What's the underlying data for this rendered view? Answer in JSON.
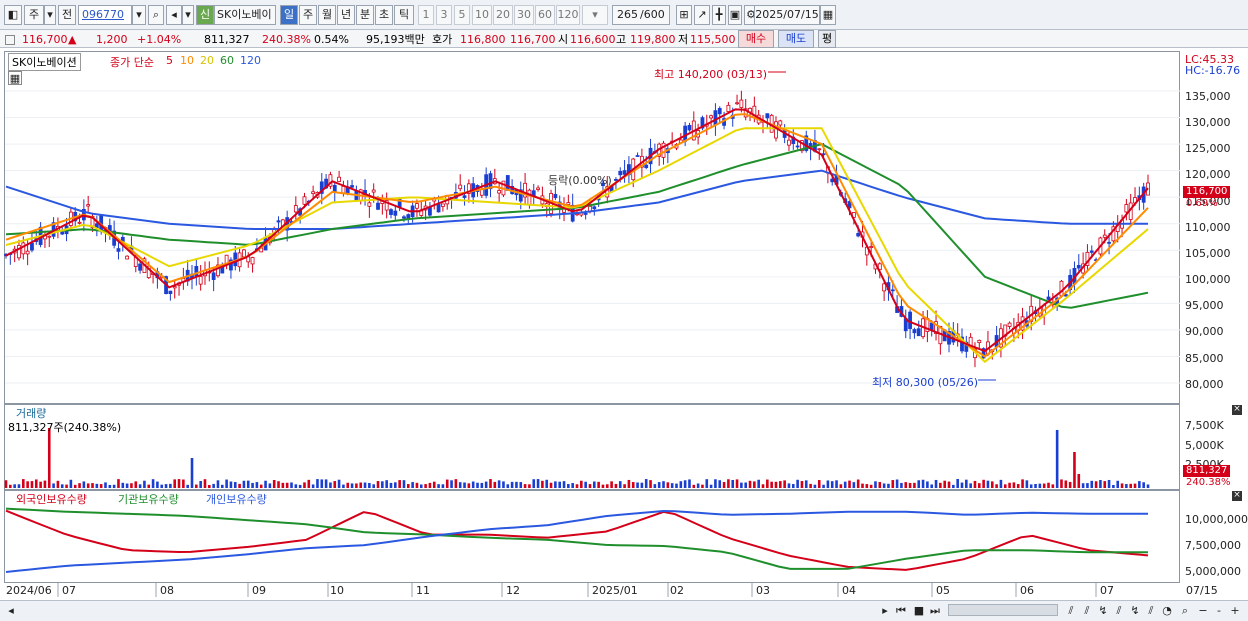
{
  "toolbar": {
    "period_type": "주",
    "prev": "전",
    "code": "096770",
    "stock_name": "SK이노베이",
    "new_badge": "신",
    "timeframes": [
      "일",
      "주",
      "월",
      "년",
      "분",
      "초",
      "틱"
    ],
    "active_timeframe": "일",
    "minute_steps": [
      "1",
      "3",
      "5",
      "10",
      "20",
      "30",
      "60",
      "120"
    ],
    "count": "265",
    "count_total": "/600",
    "date": "2025/07/15"
  },
  "quote": {
    "price": "116,700",
    "change": "1,200",
    "change_pct": "+1.04%",
    "volume": "811,327",
    "volume_ratio": "240.38%",
    "turnover": "0.54%",
    "amount": "95,193백만",
    "ask_label": "호가",
    "ask": "116,800",
    "bid": "116,700",
    "open_label": "시",
    "open": "116,600",
    "high_label": "고",
    "high": "119,800",
    "low_label": "저",
    "low": "115,500",
    "buy_label": "매수",
    "sell_label": "매도",
    "eval_label": "평"
  },
  "price_panel": {
    "name_tag": "SK이노베이션",
    "legend_prefix": "종가 단순",
    "ma": [
      {
        "label": "5",
        "color": "#d4001a"
      },
      {
        "label": "10",
        "color": "#ff8c00"
      },
      {
        "label": "20",
        "color": "#e8d800"
      },
      {
        "label": "60",
        "color": "#1f8f2c"
      },
      {
        "label": "120",
        "color": "#2b58e0"
      }
    ],
    "lc": "LC:45.33",
    "hc": "HC:-16.76",
    "y_ticks": [
      "135,000",
      "130,000",
      "125,000",
      "120,000",
      "115,000",
      "110,000",
      "105,000",
      "100,000",
      "95,000",
      "90,000",
      "85,000",
      "80,000"
    ],
    "last_price_tag": "116,700",
    "last_pct_tag": "0.69%",
    "max_label": "최고 140,200 (03/13)",
    "min_label": "최저 80,300 (05/26)",
    "mid_label": "등락(0.00%)"
  },
  "volume_panel": {
    "title": "거래량",
    "value": "811,327주(240.38%)",
    "y_ticks": [
      "7,500K",
      "5,000K",
      "2,500K"
    ],
    "last_tag": "811,327",
    "last_pct": "240.38%"
  },
  "holding_panel": {
    "legend": [
      {
        "label": "외국인보유수량",
        "color": "#d4001a"
      },
      {
        "label": "기관보유수량",
        "color": "#1f8f2c"
      },
      {
        "label": "개인보유수량",
        "color": "#2b58e0"
      }
    ],
    "y_ticks": [
      "10,000,000",
      "7,500,000",
      "5,000,000"
    ]
  },
  "x_axis": {
    "labels": [
      "2024/06",
      "07",
      "08",
      "09",
      "10",
      "11",
      "12",
      "2025/01",
      "02",
      "03",
      "04",
      "05",
      "06",
      "07"
    ],
    "right_label": "07/15"
  },
  "colors": {
    "up": "#d4001a",
    "down": "#1a3fd0"
  },
  "chart_data": {
    "type": "line",
    "title": "SK이노베이션",
    "x": [
      "2024/06",
      "07",
      "08",
      "09",
      "10",
      "11",
      "12",
      "2025/01",
      "02",
      "03",
      "04",
      "05",
      "06",
      "07",
      "07/15"
    ],
    "series": [
      {
        "name": "종가 단순 5",
        "values": [
          104000,
          112000,
          98000,
          104000,
          118000,
          112000,
          118000,
          112000,
          124000,
          132000,
          123000,
          92000,
          86000,
          98000,
          116700
        ]
      },
      {
        "name": "종가 단순 10",
        "values": [
          107000,
          112000,
          99000,
          104000,
          116000,
          114000,
          117000,
          113000,
          123000,
          131000,
          125000,
          95000,
          85000,
          97000,
          113000
        ]
      },
      {
        "name": "종가 단순 20",
        "values": [
          106000,
          110000,
          102000,
          106000,
          114000,
          115000,
          114000,
          113000,
          120000,
          128000,
          128000,
          99000,
          84000,
          96000,
          109000
        ]
      },
      {
        "name": "종가 단순 60",
        "values": [
          108000,
          109000,
          107000,
          106000,
          109000,
          111000,
          112000,
          113000,
          116000,
          121000,
          125000,
          117000,
          100000,
          94000,
          97000
        ]
      },
      {
        "name": "종가 단순 120",
        "values": [
          117000,
          112000,
          110000,
          109000,
          109000,
          110000,
          111000,
          112000,
          114000,
          118000,
          120000,
          115000,
          111000,
          110000,
          110000
        ]
      }
    ],
    "annotations": [
      "최고 140,200 (03/13)",
      "최저 80,300 (05/26)"
    ],
    "ylim": [
      78000,
      140000
    ]
  }
}
